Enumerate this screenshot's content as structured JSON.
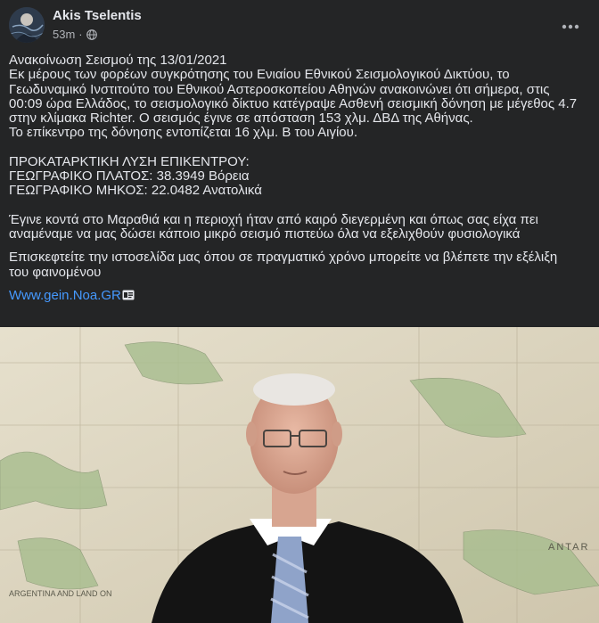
{
  "post": {
    "author": "Akis Tselentis",
    "time": "53m",
    "separator": "·",
    "privacy_icon": "globe-icon",
    "more_icon": "ellipsis-icon",
    "lines": [
      "Ανακοίνωση Σεισμού της 13/01/2021",
      "Εκ μέρους των φορέων συγκρότησης του Ενιαίου Εθνικού Σεισμολογικού Δικτύου, το",
      "Γεωδυναμικό Ινστιτούτο του Εθνικού Αστεροσκοπείου Αθηνών ανακοινώνει ότι σήμερα, στις",
      "00:09 ώρα Ελλάδος, το σεισμολογικό δίκτυο κατέγραψε Ασθενή σεισμική δόνηση με μέγεθος 4.7",
      "στην κλίμακα Richter. Ο σεισμός έγινε σε απόσταση 153 χλμ. ΔΒΔ της Αθήνας.",
      "Το επίκεντρο της δόνησης εντοπίζεται 16 χλμ. Β του Αιγίου."
    ],
    "solution_lines": [
      "ΠΡΟΚΑΤΑΡΚΤΙΚΗ ΛΥΣΗ ΕΠΙΚΕΝΤΡΟΥ:",
      "ΓΕΩΓΡΑΦΙΚΟ ΠΛΑΤΟΣ: 38.3949 Βόρεια",
      "ΓΕΩΓΡΑΦΙΚΟ ΜΗΚΟΣ: 22.0482 Ανατολικά"
    ],
    "comment_lines": [
      "Έγινε κοντά στο Μαραθιά και η περιοχή ήταν από καιρό διεγερμένη και όπως σας είχα πει",
      "αναμέναμε να μας δώσει κάποιο μικρό σεισμό πιστεύω όλα να εξελιχθούν φυσιολογικά"
    ],
    "website_lines": [
      "Επισκεφτείτε την ιστοσελίδα μας όπου σε πραγματικό χρόνο μπορείτε να βλέπετε την εξέλιξη",
      "του φαινομένου"
    ],
    "link_text": "Www.gein.Noa.GR",
    "link_icon": "external-link-icon",
    "map_labels": {
      "left": "ARGENTINA AND LAND ON",
      "right": "ANTAR"
    },
    "colors": {
      "background": "#242526",
      "text": "#e4e6eb",
      "secondary": "#b0b3b8",
      "link": "#4599ff"
    }
  }
}
